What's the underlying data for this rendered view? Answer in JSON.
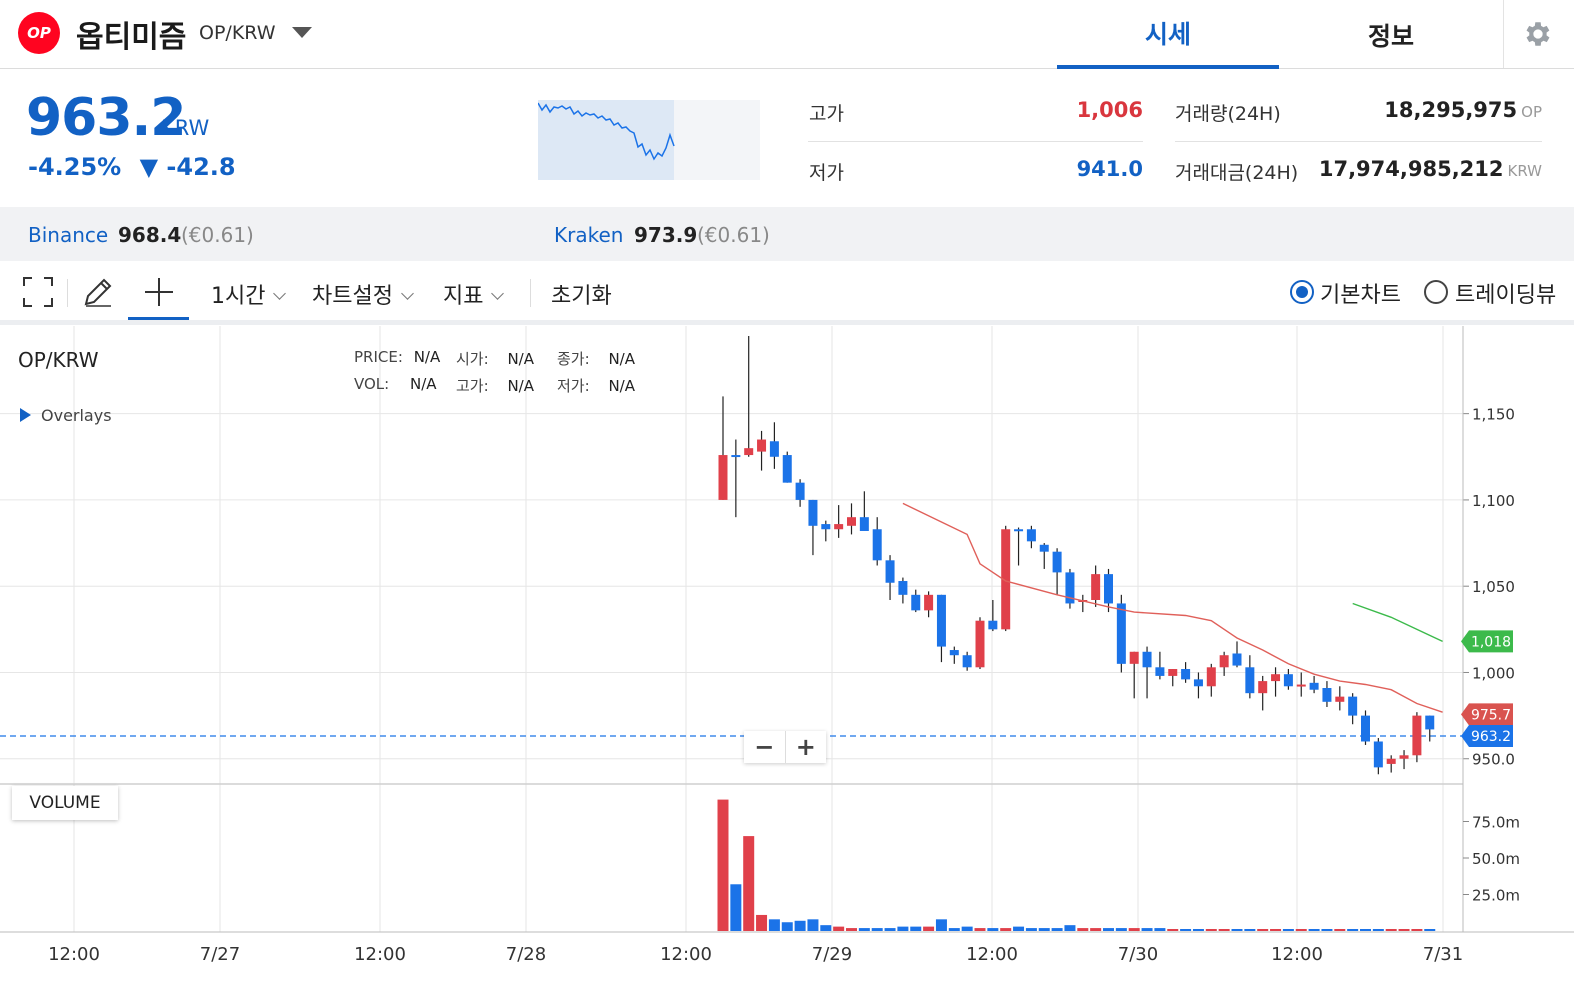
{
  "header": {
    "logo_text": "OP",
    "coin_name": "옵티미즘",
    "pair": "OP/KRW",
    "tabs": [
      "시세",
      "정보"
    ],
    "active_tab": "시세"
  },
  "ticker": {
    "price": "963.2",
    "unit": "KRW",
    "change_percent": "-4.25%",
    "change_amount": "▼ -42.8",
    "high_label": "고가",
    "high_value": "1,006",
    "low_label": "저가",
    "low_value": "941.0",
    "volume_label": "거래량(24H)",
    "volume_value": "18,295,975",
    "volume_unit": "OP",
    "amount_label": "거래대금(24H)",
    "amount_value": "17,974,985,212",
    "amount_unit": "KRW"
  },
  "exchanges": [
    {
      "name": "Binance",
      "price": "968.4",
      "sub": "(€0.61)"
    },
    {
      "name": "Kraken",
      "price": "973.9",
      "sub": "(€0.61)"
    }
  ],
  "toolbar": {
    "interval": "1시간",
    "chart_settings": "차트설정",
    "indicators": "지표",
    "reset": "초기화",
    "radio_basic": "기본차트",
    "radio_tradingview": "트레이딩뷰",
    "selected_radio": "기본차트"
  },
  "chart": {
    "title": "OP/KRW",
    "legend": {
      "price_label": "PRICE:",
      "price_value": "N/A",
      "open_label": "시가:",
      "open_value": "N/A",
      "close_label": "종가:",
      "close_value": "N/A",
      "vol_label": "VOL:",
      "vol_value": "N/A",
      "high_label": "고가:",
      "high_value": "N/A",
      "low_label": "저가:",
      "low_value": "N/A"
    },
    "overlays_label": "Overlays",
    "volume_label": "VOLUME",
    "zoom_out": "−",
    "zoom_in": "+",
    "colors": {
      "up": "#e0404a",
      "down": "#1b73e8",
      "ma_short": "#e0605a",
      "ma_long": "#3cba4b",
      "current": "#1b73e8"
    }
  },
  "chart_data": {
    "type": "candlestick",
    "title": "OP/KRW",
    "x_tick_labels": [
      "12:00",
      "7/27",
      "12:00",
      "7/28",
      "12:00",
      "7/29",
      "12:00",
      "7/30",
      "12:00",
      "7/31"
    ],
    "y_tick_labels": [
      "1,150",
      "1,100",
      "1,050",
      "1,000",
      "950.0"
    ],
    "ylim": [
      940,
      1195
    ],
    "volume_tick_labels": [
      "75.0m",
      "50.0m",
      "25.0m"
    ],
    "price_badges": [
      {
        "label": "1,018",
        "value": 1018,
        "color": "#3cba4b"
      },
      {
        "label": "975.7",
        "value": 975.7,
        "color": "#d9534f"
      },
      {
        "label": "963.2",
        "value": 963.2,
        "color": "#1b73e8"
      }
    ],
    "candles": [
      {
        "o": 1100,
        "h": 1160,
        "l": 1100,
        "c": 1126,
        "v": 90
      },
      {
        "o": 1126,
        "h": 1135,
        "l": 1090,
        "c": 1125,
        "v": 32
      },
      {
        "o": 1126,
        "h": 1195,
        "l": 1125,
        "c": 1130,
        "v": 65
      },
      {
        "o": 1128,
        "h": 1140,
        "l": 1117,
        "c": 1135,
        "v": 11
      },
      {
        "o": 1134,
        "h": 1145,
        "l": 1118,
        "c": 1125,
        "v": 8
      },
      {
        "o": 1126,
        "h": 1128,
        "l": 1110,
        "c": 1110,
        "v": 6
      },
      {
        "o": 1110,
        "h": 1112,
        "l": 1096,
        "c": 1100,
        "v": 7
      },
      {
        "o": 1100,
        "h": 1100,
        "l": 1068,
        "c": 1085,
        "v": 8
      },
      {
        "o": 1086,
        "h": 1088,
        "l": 1076,
        "c": 1083,
        "v": 4
      },
      {
        "o": 1083,
        "h": 1097,
        "l": 1078,
        "c": 1086,
        "v": 3
      },
      {
        "o": 1085,
        "h": 1098,
        "l": 1080,
        "c": 1090,
        "v": 2
      },
      {
        "o": 1090,
        "h": 1105,
        "l": 1083,
        "c": 1082,
        "v": 2
      },
      {
        "o": 1083,
        "h": 1090,
        "l": 1062,
        "c": 1065,
        "v": 2
      },
      {
        "o": 1065,
        "h": 1068,
        "l": 1042,
        "c": 1052,
        "v": 2
      },
      {
        "o": 1053,
        "h": 1055,
        "l": 1040,
        "c": 1045,
        "v": 3
      },
      {
        "o": 1045,
        "h": 1048,
        "l": 1035,
        "c": 1036,
        "v": 3
      },
      {
        "o": 1036,
        "h": 1047,
        "l": 1032,
        "c": 1045,
        "v": 3
      },
      {
        "o": 1045,
        "h": 1045,
        "l": 1006,
        "c": 1015,
        "v": 8
      },
      {
        "o": 1013,
        "h": 1015,
        "l": 1005,
        "c": 1010,
        "v": 2
      },
      {
        "o": 1010,
        "h": 1012,
        "l": 1001,
        "c": 1003,
        "v": 3
      },
      {
        "o": 1003,
        "h": 1032,
        "l": 1002,
        "c": 1030,
        "v": 2
      },
      {
        "o": 1030,
        "h": 1042,
        "l": 1024,
        "c": 1025,
        "v": 2
      },
      {
        "o": 1025,
        "h": 1085,
        "l": 1024,
        "c": 1083,
        "v": 2
      },
      {
        "o": 1083,
        "h": 1084,
        "l": 1062,
        "c": 1082,
        "v": 3
      },
      {
        "o": 1083,
        "h": 1085,
        "l": 1072,
        "c": 1076,
        "v": 2
      },
      {
        "o": 1074,
        "h": 1075,
        "l": 1060,
        "c": 1070,
        "v": 2
      },
      {
        "o": 1070,
        "h": 1072,
        "l": 1045,
        "c": 1058,
        "v": 2
      },
      {
        "o": 1058,
        "h": 1060,
        "l": 1037,
        "c": 1040,
        "v": 4
      },
      {
        "o": 1041,
        "h": 1045,
        "l": 1035,
        "c": 1042,
        "v": 2
      },
      {
        "o": 1042,
        "h": 1062,
        "l": 1038,
        "c": 1057,
        "v": 2
      },
      {
        "o": 1057,
        "h": 1060,
        "l": 1035,
        "c": 1040,
        "v": 2
      },
      {
        "o": 1040,
        "h": 1045,
        "l": 1000,
        "c": 1005,
        "v": 2
      },
      {
        "o": 1005,
        "h": 1012,
        "l": 985,
        "c": 1012,
        "v": 2
      },
      {
        "o": 1012,
        "h": 1015,
        "l": 985,
        "c": 1003,
        "v": 2
      },
      {
        "o": 1003,
        "h": 1012,
        "l": 996,
        "c": 998,
        "v": 2
      },
      {
        "o": 998,
        "h": 1002,
        "l": 992,
        "c": 1002,
        "v": 1
      },
      {
        "o": 1002,
        "h": 1006,
        "l": 994,
        "c": 996,
        "v": 1
      },
      {
        "o": 996,
        "h": 1000,
        "l": 985,
        "c": 992,
        "v": 1
      },
      {
        "o": 992,
        "h": 1005,
        "l": 986,
        "c": 1003,
        "v": 1
      },
      {
        "o": 1003,
        "h": 1012,
        "l": 998,
        "c": 1010,
        "v": 1
      },
      {
        "o": 1011,
        "h": 1018,
        "l": 1003,
        "c": 1004,
        "v": 1
      },
      {
        "o": 1003,
        "h": 1010,
        "l": 985,
        "c": 988,
        "v": 1
      },
      {
        "o": 988,
        "h": 998,
        "l": 978,
        "c": 995,
        "v": 1
      },
      {
        "o": 995,
        "h": 1003,
        "l": 986,
        "c": 999,
        "v": 1
      },
      {
        "o": 999,
        "h": 1002,
        "l": 990,
        "c": 992,
        "v": 1
      },
      {
        "o": 992,
        "h": 1000,
        "l": 986,
        "c": 993,
        "v": 1
      },
      {
        "o": 994,
        "h": 998,
        "l": 988,
        "c": 990,
        "v": 1
      },
      {
        "o": 991,
        "h": 995,
        "l": 980,
        "c": 983,
        "v": 1
      },
      {
        "o": 983,
        "h": 992,
        "l": 978,
        "c": 986,
        "v": 1
      },
      {
        "o": 986,
        "h": 988,
        "l": 970,
        "c": 975,
        "v": 1
      },
      {
        "o": 975,
        "h": 978,
        "l": 958,
        "c": 960,
        "v": 1
      },
      {
        "o": 960,
        "h": 962,
        "l": 941,
        "c": 945,
        "v": 1
      },
      {
        "o": 947,
        "h": 952,
        "l": 942,
        "c": 950,
        "v": 1
      },
      {
        "o": 950,
        "h": 955,
        "l": 944,
        "c": 952,
        "v": 1
      },
      {
        "o": 952,
        "h": 977,
        "l": 948,
        "c": 975,
        "v": 1
      },
      {
        "o": 975,
        "h": 975,
        "l": 960,
        "c": 967,
        "v": 1
      }
    ],
    "ma_short": [
      [
        14,
        1098
      ],
      [
        19,
        1080
      ],
      [
        20,
        1063
      ],
      [
        22,
        1053
      ],
      [
        26,
        1045
      ],
      [
        30,
        1038
      ],
      [
        32,
        1035
      ],
      [
        36,
        1033
      ],
      [
        38,
        1030
      ],
      [
        40,
        1020
      ],
      [
        42,
        1013
      ],
      [
        44,
        1005
      ],
      [
        46,
        999
      ],
      [
        48,
        995
      ],
      [
        50,
        993
      ],
      [
        52,
        990
      ],
      [
        54,
        982
      ],
      [
        56,
        977
      ]
    ],
    "ma_long": [
      [
        49,
        1040
      ],
      [
        52,
        1032
      ],
      [
        56,
        1018
      ]
    ]
  }
}
